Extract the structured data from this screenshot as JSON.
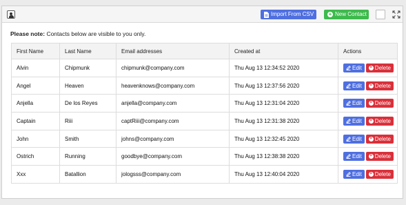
{
  "toolbar": {
    "import_label": "Import From CSV",
    "new_contact_label": "New Contact"
  },
  "note": {
    "bold": "Please note:",
    "text": " Contacts below are visible to you only."
  },
  "table": {
    "headers": {
      "first_name": "First Name",
      "last_name": "Last Name",
      "email": "Email addresses",
      "created": "Created at",
      "actions": "Actions"
    },
    "edit_label": "Edit",
    "delete_label": "Delete",
    "rows": [
      {
        "first": "Alvin",
        "last": "Chipmunk",
        "email": "chipmunk@company.com",
        "created": "Thu Aug 13 12:34:52 2020"
      },
      {
        "first": "Angel",
        "last": "Heaven",
        "email": "heavenknows@company.com",
        "created": "Thu Aug 13 12:37:56 2020"
      },
      {
        "first": "Anjella",
        "last": "De los Reyes",
        "email": "anjella@company.com",
        "created": "Thu Aug 13 12:31:04 2020"
      },
      {
        "first": "Captain",
        "last": "Riii",
        "email": "captRiii@company.com",
        "created": "Thu Aug 13 12:31:38 2020"
      },
      {
        "first": "John",
        "last": "Smith",
        "email": "johns@company.com",
        "created": "Thu Aug 13 12:32:45 2020"
      },
      {
        "first": "Ostrich",
        "last": "Running",
        "email": "goodbye@company.com",
        "created": "Thu Aug 13 12:38:38 2020"
      },
      {
        "first": "Xxx",
        "last": "Batallion",
        "email": "jologsss@company.com",
        "created": "Thu Aug 13 12:40:04 2020"
      }
    ]
  },
  "colors": {
    "primary": "#4f6fe0",
    "success": "#3dba4c",
    "danger": "#d9303a"
  },
  "icons": [
    "contact-book-icon",
    "file-icon",
    "plus-circle-icon",
    "expand-icon",
    "edit-icon",
    "x-circle-icon"
  ]
}
